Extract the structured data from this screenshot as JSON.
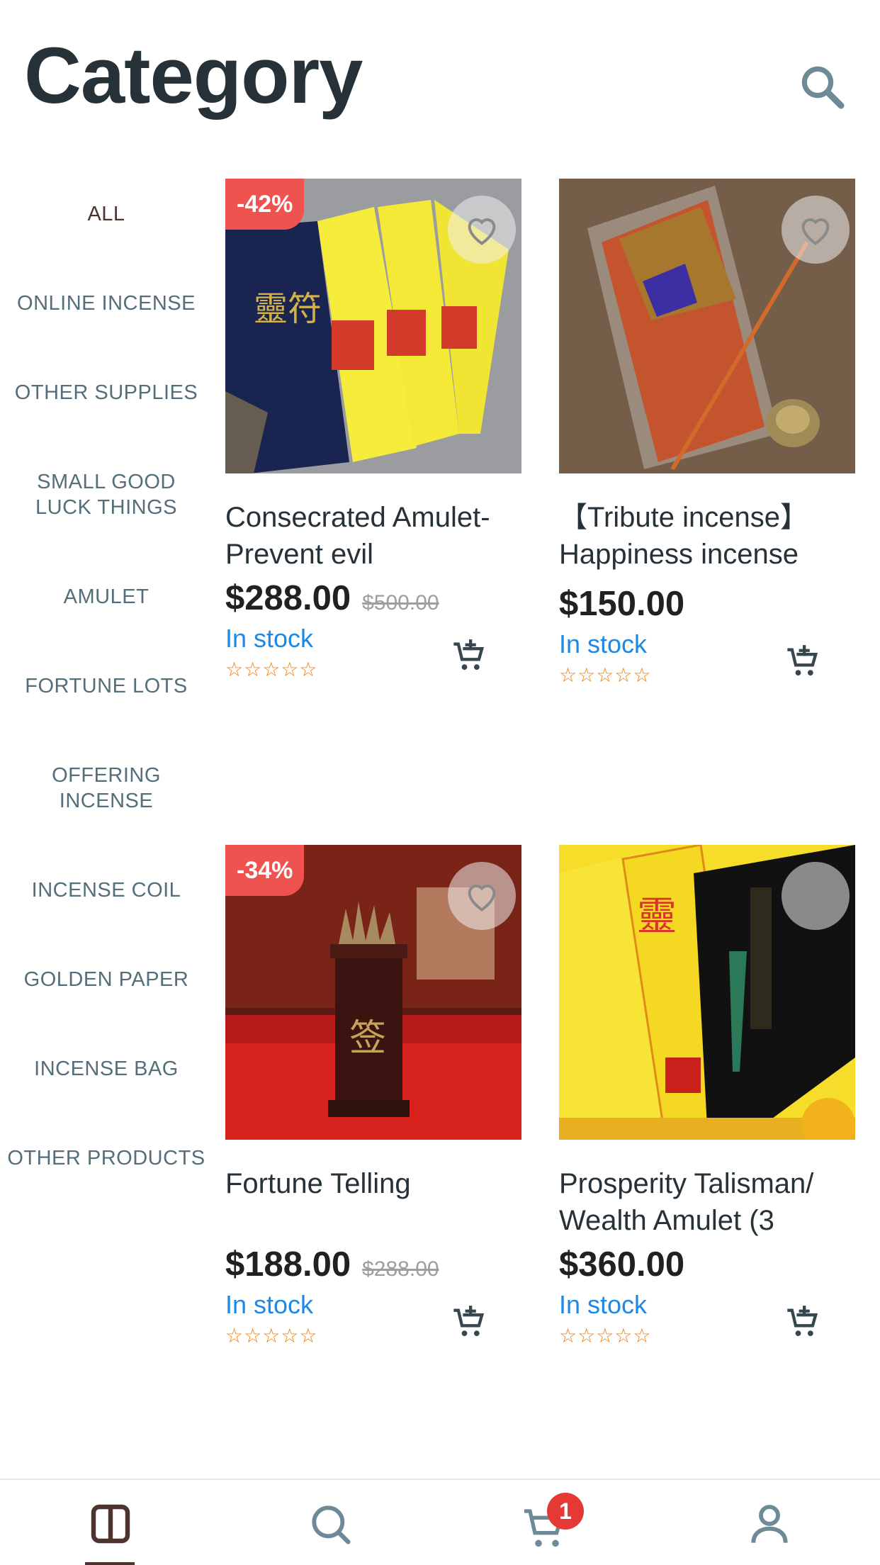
{
  "header": {
    "title": "Category",
    "search_icon": "search-icon"
  },
  "sidebar": {
    "items": [
      {
        "label": "ALL",
        "active": true
      },
      {
        "label": "ONLINE INCENSE"
      },
      {
        "label": "OTHER SUPPLIES"
      },
      {
        "label": "SMALL GOOD LUCK THINGS"
      },
      {
        "label": "AMULET"
      },
      {
        "label": "FORTUNE LOTS"
      },
      {
        "label": "OFFERING INCENSE"
      },
      {
        "label": "INCENSE COIL"
      },
      {
        "label": "GOLDEN PAPER"
      },
      {
        "label": "INCENSE BAG"
      },
      {
        "label": "OTHER PRODUCTS"
      }
    ]
  },
  "products": [
    {
      "discount": "-42%",
      "name": " Consecrated Amulet-Prevent evil",
      "price": "$288.00",
      "old_price": "$500.00",
      "stock": "In stock",
      "rating": "☆☆☆☆☆"
    },
    {
      "discount": "",
      "name": "【Tribute incense】 Happiness incense",
      "price": "$150.00",
      "old_price": "",
      "stock": "In stock",
      "rating": "☆☆☆☆☆"
    },
    {
      "discount": "-34%",
      "name": "Fortune Telling",
      "price": "$188.00",
      "old_price": "$288.00",
      "stock": "In stock",
      "rating": "☆☆☆☆☆"
    },
    {
      "discount": "",
      "name": "Prosperity Talisman/ Wealth Amulet (3",
      "price": "$360.00",
      "old_price": "",
      "stock": "In stock",
      "rating": "☆☆☆☆☆"
    }
  ],
  "bottom_nav": {
    "items": [
      "category-icon",
      "search-icon",
      "cart-icon",
      "account-icon"
    ],
    "active": "category-icon",
    "cart_badge": "1"
  },
  "colors": {
    "accent": "#4e342e",
    "discount": "#ef5350",
    "stock": "#1e88e5",
    "stars": "#f57c00",
    "badge": "#e53935"
  }
}
